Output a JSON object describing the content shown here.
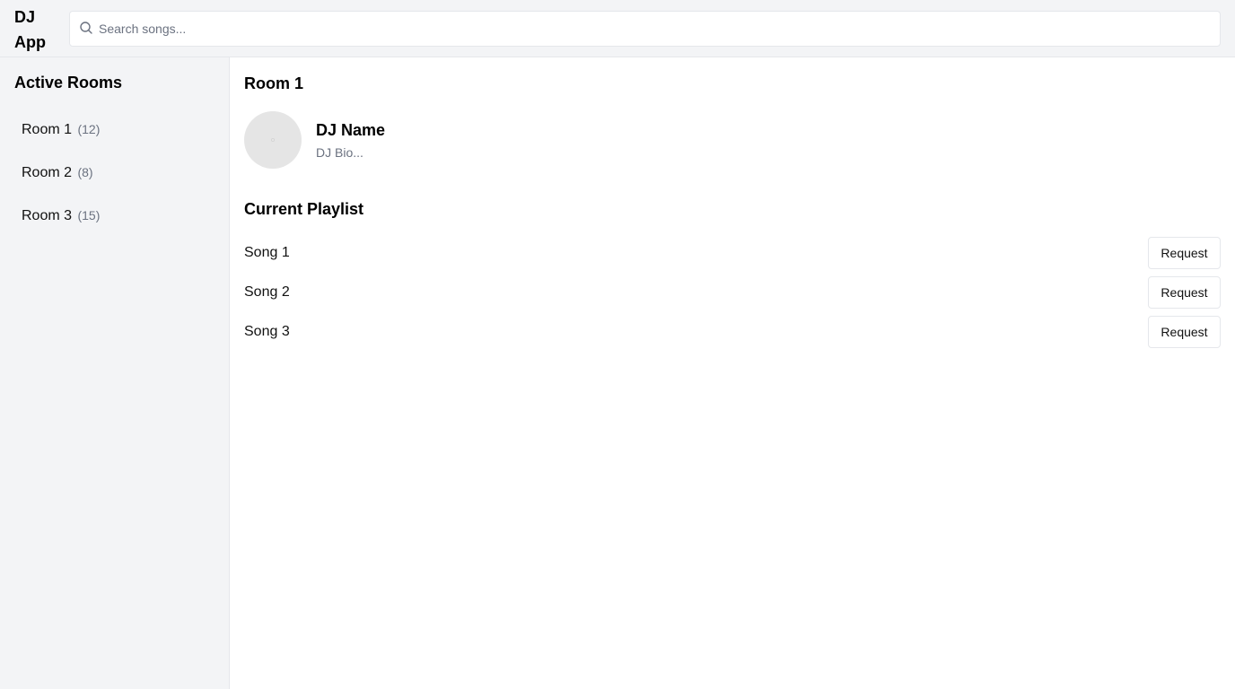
{
  "header": {
    "app_title": "DJ App",
    "search": {
      "placeholder": "Search songs...",
      "value": ""
    }
  },
  "sidebar": {
    "title": "Active Rooms",
    "rooms": [
      {
        "name": "Room 1",
        "count": "(12)"
      },
      {
        "name": "Room 2",
        "count": "(8)"
      },
      {
        "name": "Room 3",
        "count": "(15)"
      }
    ]
  },
  "main": {
    "room_title": "Room 1",
    "dj": {
      "name": "DJ Name",
      "bio": "DJ Bio..."
    },
    "playlist_title": "Current Playlist",
    "songs": [
      {
        "title": "Song 1",
        "action": "Request"
      },
      {
        "title": "Song 2",
        "action": "Request"
      },
      {
        "title": "Song 3",
        "action": "Request"
      }
    ]
  },
  "icons": {
    "search": "search-icon"
  },
  "colors": {
    "panel_bg": "#f3f4f6",
    "border": "#e5e7eb",
    "muted_text": "#6b7280",
    "avatar_bg": "#e5e5e5"
  }
}
